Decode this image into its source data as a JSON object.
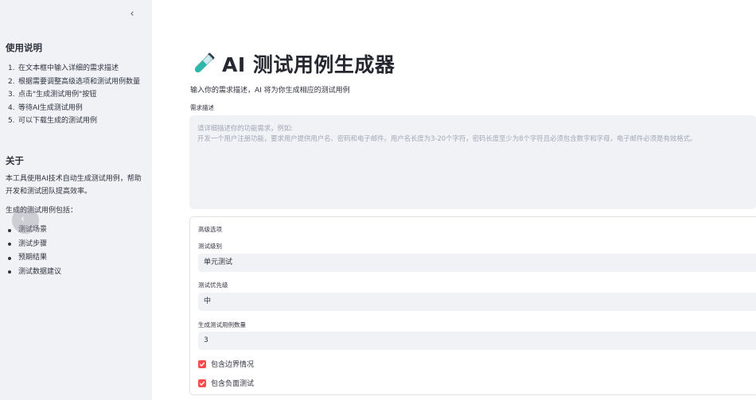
{
  "sidebar": {
    "collapse_icon": "‹",
    "instructions_title": "使用说明",
    "steps": [
      {
        "num": "1.",
        "text": "在文本框中输入详细的需求描述"
      },
      {
        "num": "2.",
        "text": "根据需要调整高级选项和测试用例数量"
      },
      {
        "num": "3.",
        "text": "点击\"生成测试用例\"按钮"
      },
      {
        "num": "4.",
        "text": "等待AI生成测试用例"
      },
      {
        "num": "5.",
        "text": "可以下载生成的测试用例"
      }
    ],
    "about_title": "关于",
    "about_text": "本工具使用AI技术自动生成测试用例，帮助开发和测试团队提高效率。",
    "includes_text": "生成的测试用例包括：",
    "includes": [
      "测试场景",
      "测试步骤",
      "预期结果",
      "测试数据建议"
    ]
  },
  "main": {
    "title": "AI 测试用例生成器",
    "subtitle": "输入你的需求描述，AI 将为你生成相应的测试用例",
    "requirement_label": "需求描述",
    "requirement_placeholder": "请详细描述你的功能需求，例如:\n开发一个用户注册功能，要求用户提供用户名、密码和电子邮件。用户名长度为3-20个字符，密码长度至少为8个字符且必须包含数字和字母，电子邮件必须是有效格式。",
    "advanced": {
      "title": "高级选项",
      "level_label": "测试级别",
      "level_value": "单元测试",
      "priority_label": "测试优先级",
      "priority_value": "中",
      "count_label": "生成测试用例数量",
      "count_value": "3",
      "checkbox_boundary": "包含边界情况",
      "checkbox_negative": "包含负面测试"
    }
  },
  "colors": {
    "sidebar_bg": "#f0f2f6",
    "accent": "#ff4b4b",
    "input_bg": "#f0f2f6"
  }
}
